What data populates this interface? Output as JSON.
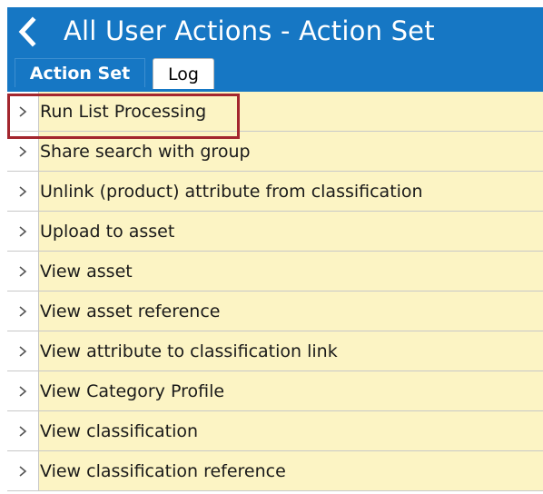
{
  "window": {
    "title": "All User Actions - Action Set",
    "back_icon": "chevron-left-icon"
  },
  "tabs": [
    {
      "label": "Action Set",
      "active": true
    },
    {
      "label": "Log",
      "active": false
    }
  ],
  "actions": [
    {
      "label": "Run List Processing",
      "highlighted": true
    },
    {
      "label": "Share search with group"
    },
    {
      "label": "Unlink (product) attribute from classification"
    },
    {
      "label": "Upload to asset"
    },
    {
      "label": "View asset"
    },
    {
      "label": "View asset reference"
    },
    {
      "label": "View attribute to classification link"
    },
    {
      "label": "View Category Profile"
    },
    {
      "label": "View classification"
    },
    {
      "label": "View classification reference"
    }
  ],
  "colors": {
    "header": "#1677c4",
    "row_background": "#fcf4c4",
    "highlight_border": "#a3262e"
  }
}
